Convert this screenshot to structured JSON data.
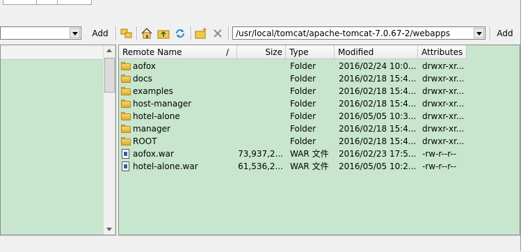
{
  "top_strip": {
    "fragment_labels": [
      "",
      ""
    ]
  },
  "local_toolbar": {
    "path_value": "",
    "add_label": "Add"
  },
  "remote_toolbar": {
    "path_value": "/usr/local/tomcat/apache-tomcat-7.0.67-2/webapps",
    "add_label": "Add",
    "icons": [
      "folder-tree-icon",
      "home-icon",
      "parent-folder-icon",
      "refresh-icon",
      "new-folder-icon",
      "delete-icon"
    ]
  },
  "remote_list": {
    "columns": {
      "name": "Remote Name",
      "sort_marker": "/",
      "size": "Size",
      "type": "Type",
      "modified": "Modified",
      "attributes": "Attributes"
    },
    "rows": [
      {
        "name": "aofox",
        "size": "",
        "type": "Folder",
        "modified": "2016/02/24 10:0...",
        "attributes": "drwxr-xr...",
        "icon": "folder"
      },
      {
        "name": "docs",
        "size": "",
        "type": "Folder",
        "modified": "2016/02/18 15:4...",
        "attributes": "drwxr-xr...",
        "icon": "folder"
      },
      {
        "name": "examples",
        "size": "",
        "type": "Folder",
        "modified": "2016/02/18 15:4...",
        "attributes": "drwxr-xr...",
        "icon": "folder"
      },
      {
        "name": "host-manager",
        "size": "",
        "type": "Folder",
        "modified": "2016/02/18 15:4...",
        "attributes": "drwxr-xr...",
        "icon": "folder"
      },
      {
        "name": "hotel-alone",
        "size": "",
        "type": "Folder",
        "modified": "2016/05/05 10:3...",
        "attributes": "drwxr-xr...",
        "icon": "folder"
      },
      {
        "name": "manager",
        "size": "",
        "type": "Folder",
        "modified": "2016/02/18 15:4...",
        "attributes": "drwxr-xr...",
        "icon": "folder"
      },
      {
        "name": "ROOT",
        "size": "",
        "type": "Folder",
        "modified": "2016/02/18 15:4...",
        "attributes": "drwxr-xr...",
        "icon": "folder"
      },
      {
        "name": "aofox.war",
        "size": "73,937,2...",
        "type": "WAR 文件",
        "modified": "2016/02/23 17:5...",
        "attributes": "-rw-r--r--",
        "icon": "file"
      },
      {
        "name": "hotel-alone.war",
        "size": "61,536,2...",
        "type": "WAR 文件",
        "modified": "2016/05/05 10:2...",
        "attributes": "-rw-r--r--",
        "icon": "file"
      }
    ]
  },
  "colors": {
    "list_background": "#c8e6cd",
    "window_background": "#f0f0f0"
  }
}
